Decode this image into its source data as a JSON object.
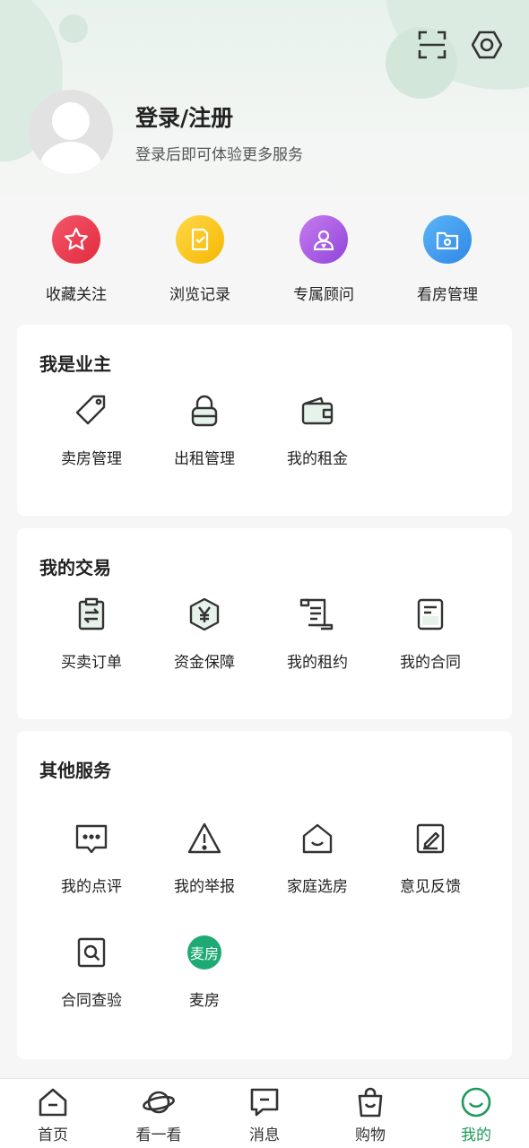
{
  "colors": {
    "accent": "#1e9a5a",
    "collect_red": "#e8384c",
    "history_yellow": "#f7c414",
    "advisor_purple": "#a95ee4",
    "viewing_blue": "#3f97ec"
  },
  "header": {
    "scan_icon": "scan-icon",
    "settings_icon": "settings-hexagon-icon",
    "login_title": "登录/注册",
    "login_subtitle": "登录后即可体验更多服务"
  },
  "quick_actions": [
    {
      "label": "收藏关注",
      "icon": "star-icon"
    },
    {
      "label": "浏览记录",
      "icon": "history-check-icon"
    },
    {
      "label": "专属顾问",
      "icon": "advisor-icon"
    },
    {
      "label": "看房管理",
      "icon": "folder-gear-icon"
    }
  ],
  "owner_section": {
    "title": "我是业主",
    "items": [
      {
        "label": "卖房管理",
        "icon": "tag-icon"
      },
      {
        "label": "出租管理",
        "icon": "lock-icon"
      },
      {
        "label": "我的租金",
        "icon": "wallet-icon"
      }
    ]
  },
  "trade_section": {
    "title": "我的交易",
    "items": [
      {
        "label": "买卖订单",
        "icon": "exchange-clipboard-icon"
      },
      {
        "label": "资金保障",
        "icon": "yuan-shield-icon"
      },
      {
        "label": "我的租约",
        "icon": "scroll-icon"
      },
      {
        "label": "我的合同",
        "icon": "document-icon"
      }
    ]
  },
  "other_section": {
    "title": "其他服务",
    "items": [
      {
        "label": "我的点评",
        "icon": "comment-icon"
      },
      {
        "label": "我的举报",
        "icon": "warning-icon"
      },
      {
        "label": "家庭选房",
        "icon": "home-smile-icon"
      },
      {
        "label": "意见反馈",
        "icon": "edit-icon"
      },
      {
        "label": "合同查验",
        "icon": "search-frame-icon"
      },
      {
        "label": "麦房",
        "icon": "maifang-logo",
        "logo_text": "麦房"
      }
    ]
  },
  "tabbar": [
    {
      "label": "首页",
      "icon": "home-icon",
      "active": false
    },
    {
      "label": "看一看",
      "icon": "planet-icon",
      "active": false
    },
    {
      "label": "消息",
      "icon": "message-icon",
      "active": false
    },
    {
      "label": "购物",
      "icon": "shopping-bag-icon",
      "active": false
    },
    {
      "label": "我的",
      "icon": "profile-smile-icon",
      "active": true
    }
  ]
}
